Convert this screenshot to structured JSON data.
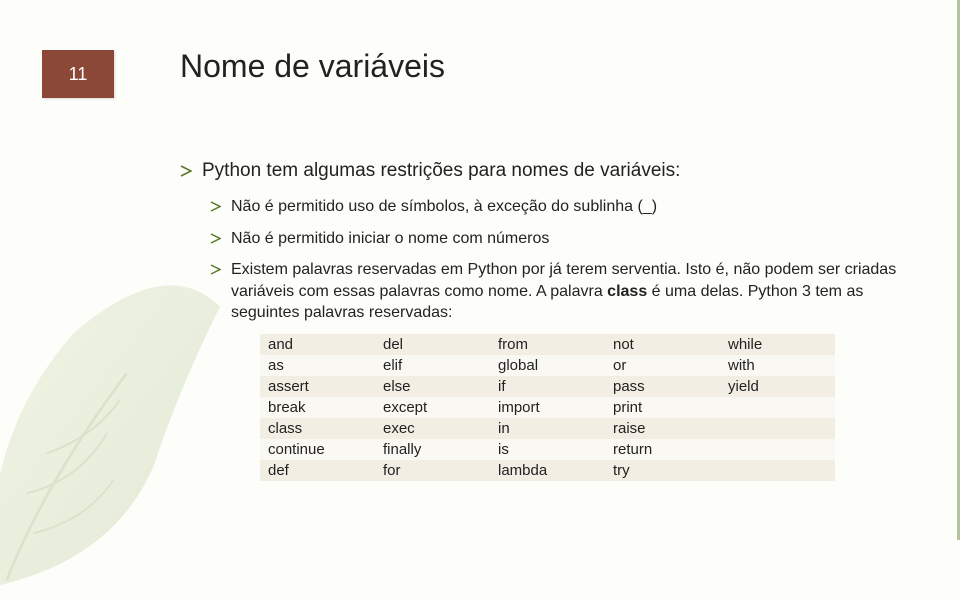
{
  "page_number": "11",
  "title": "Nome de variáveis",
  "main_point": "Python tem algumas restrições para nomes de variáveis:",
  "sub_points": [
    "Não é permitido uso de símbolos, à exceção do sublinha (_)",
    "Não é permitido iniciar o nome com números",
    "Existem palavras reservadas em Python por já terem serventia. Isto é, não podem ser criadas variáveis com essas palavras como nome. A palavra <b>class</b> é uma delas. Python 3 tem as seguintes palavras reservadas:"
  ],
  "keywords_rows": [
    [
      "and",
      "del",
      "from",
      "not",
      "while"
    ],
    [
      "as",
      "elif",
      "global",
      "or",
      "with"
    ],
    [
      "assert",
      "else",
      "if",
      "pass",
      "yield"
    ],
    [
      "break",
      "except",
      "import",
      "print",
      ""
    ],
    [
      "class",
      "exec",
      "in",
      "raise",
      ""
    ],
    [
      "continue",
      "finally",
      "is",
      "return",
      ""
    ],
    [
      "def",
      "for",
      "lambda",
      "try",
      ""
    ]
  ]
}
